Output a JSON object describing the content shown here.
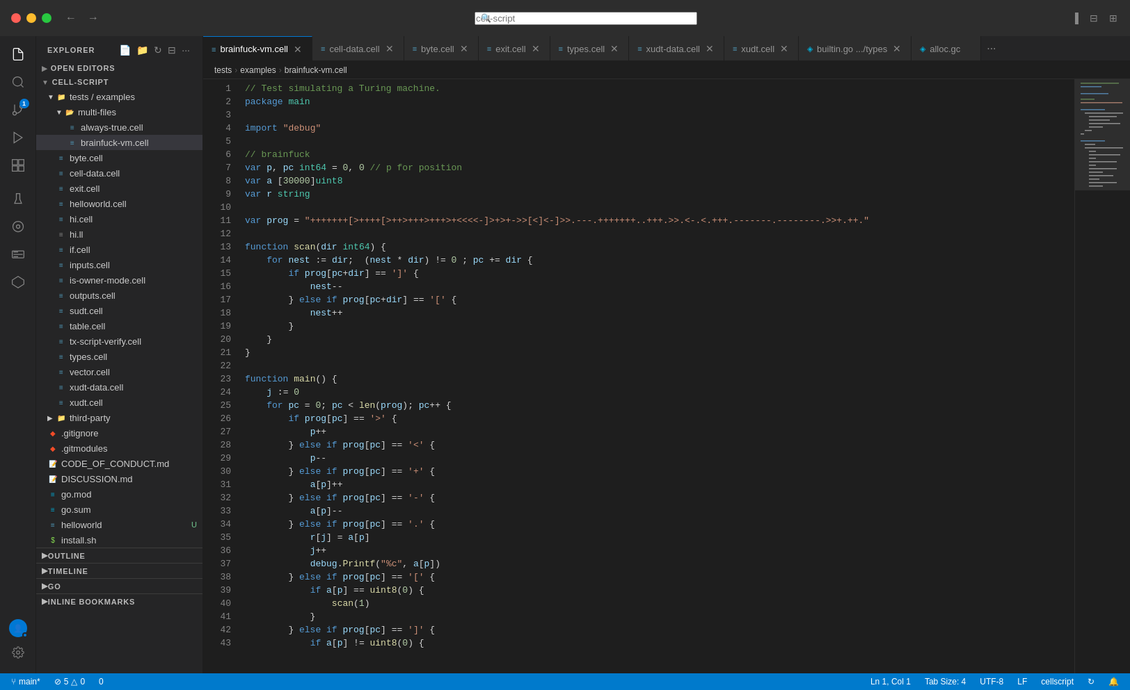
{
  "titlebar": {
    "search_placeholder": "cell-script",
    "nav_back": "←",
    "nav_forward": "→"
  },
  "tabs": [
    {
      "label": "brainfuck-vm.cell",
      "icon": "≡",
      "active": true,
      "modified": false,
      "closable": true
    },
    {
      "label": "cell-data.cell",
      "icon": "≡",
      "active": false,
      "modified": false,
      "closable": true
    },
    {
      "label": "byte.cell",
      "icon": "≡",
      "active": false,
      "modified": false,
      "closable": true
    },
    {
      "label": "exit.cell",
      "icon": "≡",
      "active": false,
      "modified": false,
      "closable": true
    },
    {
      "label": "types.cell",
      "icon": "≡",
      "active": false,
      "modified": false,
      "closable": true
    },
    {
      "label": "xudt-data.cell",
      "icon": "≡",
      "active": false,
      "modified": false,
      "closable": true
    },
    {
      "label": "xudt.cell",
      "icon": "≡",
      "active": false,
      "modified": false,
      "closable": true
    },
    {
      "label": "builtin.go .../types",
      "icon": "◈",
      "active": false,
      "modified": false,
      "closable": true
    },
    {
      "label": "alloc.gc",
      "icon": "◈",
      "active": false,
      "modified": false,
      "closable": false
    }
  ],
  "breadcrumb": {
    "parts": [
      "tests",
      "examples",
      "brainfuck-vm.cell"
    ]
  },
  "sidebar": {
    "title": "EXPLORER",
    "sections": {
      "open_editors": "OPEN EDITORS",
      "cell_script": "CELL-SCRIPT",
      "outline": "OUTLINE",
      "timeline": "TIMELINE",
      "go": "GO",
      "inline_bookmarks": "INLINE BOOKMARKS"
    },
    "tree": {
      "root": "tests / examples",
      "multi_files": "multi-files",
      "files": [
        {
          "name": "always-true.cell",
          "type": "cell",
          "indent": 3
        },
        {
          "name": "brainfuck-vm.cell",
          "type": "cell",
          "indent": 3,
          "active": true
        },
        {
          "name": "byte.cell",
          "type": "cell",
          "indent": 2
        },
        {
          "name": "cell-data.cell",
          "type": "cell",
          "indent": 2
        },
        {
          "name": "exit.cell",
          "type": "cell",
          "indent": 2
        },
        {
          "name": "helloworld.cell",
          "type": "cell",
          "indent": 2
        },
        {
          "name": "hi.cell",
          "type": "cell",
          "indent": 2
        },
        {
          "name": "hi.ll",
          "type": "cell",
          "indent": 2
        },
        {
          "name": "if.cell",
          "type": "cell",
          "indent": 2
        },
        {
          "name": "inputs.cell",
          "type": "cell",
          "indent": 2
        },
        {
          "name": "is-owner-mode.cell",
          "type": "cell",
          "indent": 2
        },
        {
          "name": "outputs.cell",
          "type": "cell",
          "indent": 2
        },
        {
          "name": "sudt.cell",
          "type": "cell",
          "indent": 2
        },
        {
          "name": "table.cell",
          "type": "cell",
          "indent": 2
        },
        {
          "name": "tx-script-verify.cell",
          "type": "cell",
          "indent": 2
        },
        {
          "name": "types.cell",
          "type": "cell",
          "indent": 2
        },
        {
          "name": "vector.cell",
          "type": "cell",
          "indent": 2
        },
        {
          "name": "xudt-data.cell",
          "type": "cell",
          "indent": 2
        },
        {
          "name": "xudt.cell",
          "type": "cell",
          "indent": 2
        },
        {
          "name": "third-party",
          "type": "folder",
          "indent": 1
        },
        {
          "name": ".gitignore",
          "type": "git",
          "indent": 1
        },
        {
          "name": ".gitmodules",
          "type": "git",
          "indent": 1
        },
        {
          "name": "CODE_OF_CONDUCT.md",
          "type": "md",
          "indent": 1
        },
        {
          "name": "DISCUSSION.md",
          "type": "md",
          "indent": 1
        },
        {
          "name": "go.mod",
          "type": "mod",
          "indent": 1
        },
        {
          "name": "go.sum",
          "type": "mod",
          "indent": 1
        },
        {
          "name": "helloworld",
          "type": "cell",
          "indent": 1,
          "badge": "U"
        },
        {
          "name": "install.sh",
          "type": "sh",
          "indent": 1
        }
      ]
    }
  },
  "code": {
    "lines": [
      {
        "n": 1,
        "text": "// Test simulating a Turing machine."
      },
      {
        "n": 2,
        "text": "package main"
      },
      {
        "n": 3,
        "text": ""
      },
      {
        "n": 4,
        "text": "import \"debug\""
      },
      {
        "n": 5,
        "text": ""
      },
      {
        "n": 6,
        "text": "// brainfuck"
      },
      {
        "n": 7,
        "text": "var p, pc int64 = 0, 0 // p for position"
      },
      {
        "n": 8,
        "text": "var a [30000]uint8"
      },
      {
        "n": 9,
        "text": "var r string"
      },
      {
        "n": 10,
        "text": ""
      },
      {
        "n": 11,
        "text": "var prog = \"+++++++[>++++[>++>+++>+++>+<<<<-]>+>+->>[<]<-]>>.---.+++++++..+++.>>.<-.<.+++.-------.--------.>>+.++.\""
      },
      {
        "n": 12,
        "text": ""
      },
      {
        "n": 13,
        "text": "function scan(dir int64) {"
      },
      {
        "n": 14,
        "text": "    for nest := dir;  (nest * dir) != 0 ; pc += dir {"
      },
      {
        "n": 15,
        "text": "        if prog[pc+dir] == ']' {"
      },
      {
        "n": 16,
        "text": "            nest--"
      },
      {
        "n": 17,
        "text": "        } else if prog[pc+dir] == '[' {"
      },
      {
        "n": 18,
        "text": "            nest++"
      },
      {
        "n": 19,
        "text": "        }"
      },
      {
        "n": 20,
        "text": "    }"
      },
      {
        "n": 21,
        "text": "}"
      },
      {
        "n": 22,
        "text": ""
      },
      {
        "n": 23,
        "text": "function main() {"
      },
      {
        "n": 24,
        "text": "    j := 0"
      },
      {
        "n": 25,
        "text": "    for pc = 0; pc < len(prog); pc++ {"
      },
      {
        "n": 26,
        "text": "        if prog[pc] == '>' {"
      },
      {
        "n": 27,
        "text": "            p++"
      },
      {
        "n": 28,
        "text": "        } else if prog[pc] == '<' {"
      },
      {
        "n": 29,
        "text": "            p--"
      },
      {
        "n": 30,
        "text": "        } else if prog[pc] == '+' {"
      },
      {
        "n": 31,
        "text": "            a[p]++"
      },
      {
        "n": 32,
        "text": "        } else if prog[pc] == '-' {"
      },
      {
        "n": 33,
        "text": "            a[p]--"
      },
      {
        "n": 34,
        "text": "        } else if prog[pc] == '.' {"
      },
      {
        "n": 35,
        "text": "            r[j] = a[p]"
      },
      {
        "n": 36,
        "text": "            j++"
      },
      {
        "n": 37,
        "text": "            debug.Printf(\"%c\", a[p])"
      },
      {
        "n": 38,
        "text": "        } else if prog[pc] == '[' {"
      },
      {
        "n": 39,
        "text": "            if a[p] == uint8(0) {"
      },
      {
        "n": 40,
        "text": "                scan(1)"
      },
      {
        "n": 41,
        "text": "            }"
      },
      {
        "n": 42,
        "text": "        } else if prog[pc] == ']' {"
      },
      {
        "n": 43,
        "text": "            if a[p] != uint8(0) {"
      }
    ]
  },
  "status_bar": {
    "branch": "main*",
    "errors": "⊘ 5",
    "warnings": "△ 0",
    "info": "0",
    "ln": "Ln 1, Col 1",
    "tab_size": "Tab Size: 4",
    "encoding": "UTF-8",
    "line_ending": "LF",
    "language": "cellscript",
    "notifications": "🔔",
    "sync": "↻"
  },
  "activity_icons": [
    {
      "name": "files-icon",
      "symbol": "⎘",
      "active": true
    },
    {
      "name": "search-icon",
      "symbol": "🔍",
      "active": false
    },
    {
      "name": "source-control-icon",
      "symbol": "⑂",
      "active": false,
      "badge": true
    },
    {
      "name": "run-debug-icon",
      "symbol": "▷",
      "active": false
    },
    {
      "name": "extensions-icon",
      "symbol": "⊞",
      "active": false
    },
    {
      "name": "flask-icon",
      "symbol": "⚗",
      "active": false
    },
    {
      "name": "gitbook-icon",
      "symbol": "◉",
      "active": false
    },
    {
      "name": "docker-icon",
      "symbol": "🐳",
      "active": false
    },
    {
      "name": "remote-icon",
      "symbol": "⬡",
      "active": false
    },
    {
      "name": "settings-icon",
      "symbol": "⚙",
      "active": false
    }
  ]
}
